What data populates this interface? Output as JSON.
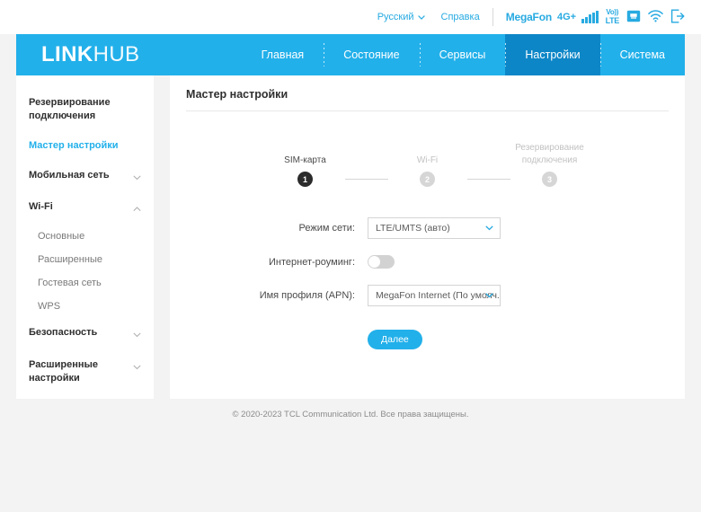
{
  "topbar": {
    "language": "Русский",
    "language_icon": "chevron-down-icon",
    "help": "Справка",
    "carrier": "MegaFon",
    "network_type": "4G+",
    "signal_icon": "signal-bars-icon",
    "signal_bars": 5,
    "volte_top": "Vo))",
    "volte_bottom": "LTE",
    "lan_icon": "ethernet-icon",
    "wifi_icon": "wifi-icon",
    "logout_icon": "logout-icon"
  },
  "brand": {
    "name_bold": "LINK",
    "name_thin": "HUB"
  },
  "nav": {
    "items": [
      {
        "label": "Главная",
        "active": false
      },
      {
        "label": "Состояние",
        "active": false
      },
      {
        "label": "Сервисы",
        "active": false
      },
      {
        "label": "Настройки",
        "active": true
      },
      {
        "label": "Система",
        "active": false
      }
    ]
  },
  "sidebar": {
    "items": [
      {
        "label": "Резервирование подключения",
        "type": "group",
        "chevron": "",
        "active": false
      },
      {
        "label": "Мастер настройки",
        "type": "link",
        "chevron": "",
        "active": true
      },
      {
        "label": "Мобильная сеть",
        "type": "group",
        "chevron": "chevron-down-icon",
        "active": false
      },
      {
        "label": "Wi-Fi",
        "type": "group",
        "chevron": "chevron-up-icon",
        "active": false
      },
      {
        "label": "Основные",
        "type": "sub",
        "chevron": "",
        "active": false
      },
      {
        "label": "Расширенные",
        "type": "sub",
        "chevron": "",
        "active": false
      },
      {
        "label": "Гостевая сеть",
        "type": "sub",
        "chevron": "",
        "active": false
      },
      {
        "label": "WPS",
        "type": "sub",
        "chevron": "",
        "active": false
      },
      {
        "label": "Безопасность",
        "type": "group",
        "chevron": "chevron-down-icon",
        "active": false
      },
      {
        "label": "Расширенные настройки",
        "type": "group",
        "chevron": "chevron-down-icon",
        "active": false
      }
    ]
  },
  "main": {
    "title": "Мастер настройки",
    "stepper": {
      "steps": [
        {
          "number": "1",
          "label": "SIM-карта",
          "state": "active"
        },
        {
          "number": "2",
          "label": "Wi-Fi",
          "state": "inactive"
        },
        {
          "number": "3",
          "label": "Резервирование\nподключения",
          "state": "inactive"
        }
      ]
    },
    "form": {
      "network_mode": {
        "label": "Режим сети:",
        "value": "LTE/UMTS (авто)",
        "chevron": "chevron-down-icon"
      },
      "roaming": {
        "label": "Интернет-роуминг:",
        "state": "off"
      },
      "apn": {
        "label": "Имя профиля (APN):",
        "value": "MegaFon Internet (По умолч...",
        "chevron": "chevron-down-icon"
      },
      "next_button": "Далее"
    }
  },
  "footer": {
    "copyright": "© 2020-2023 TCL Communication Ltd. Все права защищены."
  },
  "colors": {
    "brand_blue": "#22b0ea",
    "accent_blue": "#27aae1",
    "active_tab": "#0d86c7",
    "page_bg": "#f3f3f3",
    "card_bg": "#ffffff"
  }
}
